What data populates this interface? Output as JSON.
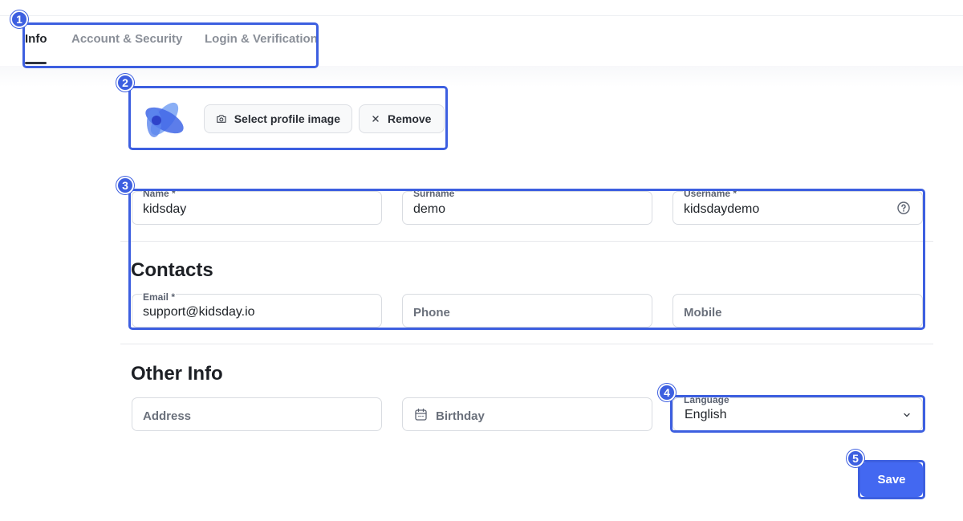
{
  "tabs": [
    {
      "label": "Info"
    },
    {
      "label": "Account & Security"
    },
    {
      "label": "Login & Verification"
    }
  ],
  "profile_image": {
    "select_label": "Select profile image",
    "remove_label": "Remove"
  },
  "personal": {
    "name": {
      "label": "Name *",
      "value": "kidsday"
    },
    "surname": {
      "label": "Surname",
      "value": "demo"
    },
    "username": {
      "label": "Username *",
      "value": "kidsdaydemo"
    }
  },
  "contacts": {
    "title": "Contacts",
    "email": {
      "label": "Email *",
      "value": "support@kidsday.io"
    },
    "phone": {
      "placeholder": "Phone"
    },
    "mobile": {
      "placeholder": "Mobile"
    }
  },
  "other_info": {
    "title": "Other Info",
    "address": {
      "placeholder": "Address"
    },
    "birthday": {
      "placeholder": "Birthday"
    },
    "language": {
      "label": "Language",
      "value": "English"
    }
  },
  "save_label": "Save",
  "annotations": [
    "1",
    "2",
    "3",
    "4",
    "5"
  ],
  "colors": {
    "accent": "#4368f1",
    "annotation": "#3d5fe0"
  }
}
